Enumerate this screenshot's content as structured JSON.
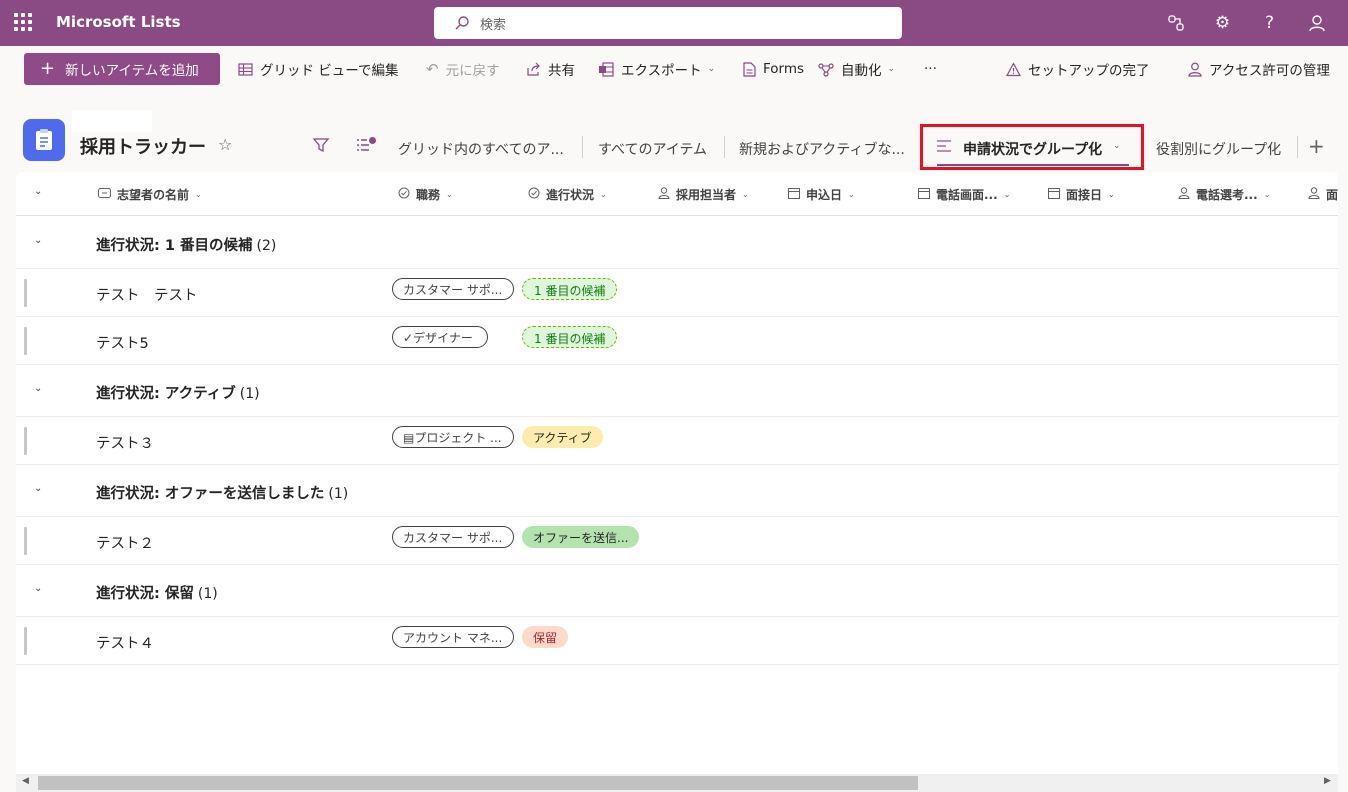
{
  "app": {
    "name": "Microsoft Lists",
    "search_placeholder": "検索"
  },
  "toolbar": {
    "new_item": "新しいアイテムを追加",
    "grid_edit": "グリッド ビューで編集",
    "undo": "元に戻す",
    "share": "共有",
    "export": "エクスポート",
    "forms": "Forms",
    "automate": "自動化",
    "more": "···",
    "setup_complete": "セットアップの完了",
    "manage_access": "アクセス許可の管理"
  },
  "list": {
    "title": "採用トラッカー"
  },
  "views": {
    "tab1": "グリッド内のすべてのア...",
    "tab2": "すべてのアイテム",
    "tab3": "新規およびアクティブな...",
    "active": "申請状況でグループ化",
    "tab5": "役割別にグループ化"
  },
  "columns": {
    "name": "志望者の名前",
    "job": "職務",
    "progress": "進行状況",
    "recruiter": "採用担当者",
    "applied": "申込日",
    "phone_screen": "電話画面...",
    "interview": "面接日",
    "phone_select": "電話選考...",
    "more": "面"
  },
  "groups": [
    {
      "label": "進行状況: 1 番目の候補",
      "count": "(2)"
    },
    {
      "label": "進行状況: アクティブ",
      "count": "(1)"
    },
    {
      "label": "進行状況: オファーを送信しました",
      "count": "(1)"
    },
    {
      "label": "進行状況: 保留",
      "count": "(1)"
    }
  ],
  "rows": [
    {
      "name": "テスト　テスト",
      "job": "カスタマー サポ...",
      "status": "1 番目の候補"
    },
    {
      "name": "テスト5",
      "job": "デザイナー",
      "status": "1 番目の候補"
    },
    {
      "name": "テスト３",
      "job": "プロジェクト ...",
      "status": "アクティブ"
    },
    {
      "name": "テスト２",
      "job": "カスタマー サポ...",
      "status": "オファーを送信..."
    },
    {
      "name": "テスト４",
      "job": "アカウント マネ...",
      "status": "保留"
    }
  ],
  "colors": {
    "brand": "#8a4a83",
    "highlight": "#e81123"
  }
}
